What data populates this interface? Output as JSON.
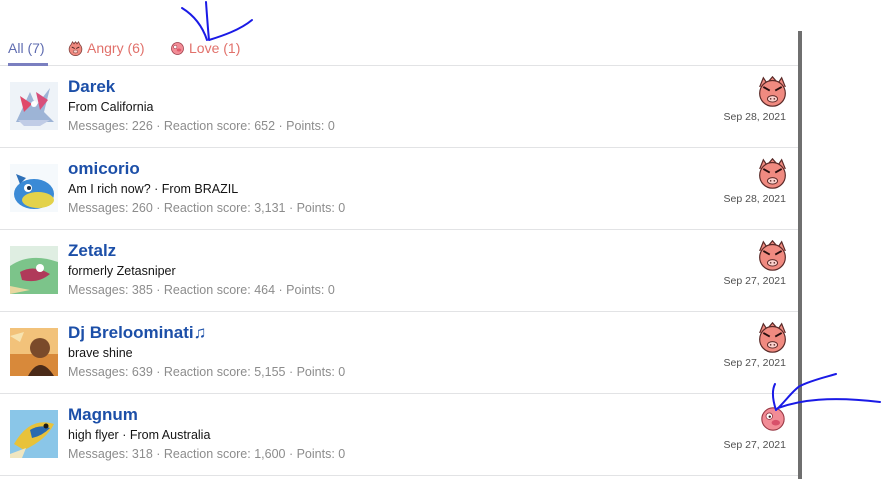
{
  "tabs": [
    {
      "label": "All (7)",
      "active": true
    },
    {
      "label": "Angry (6)",
      "icon": "angry-reaction-icon"
    },
    {
      "label": "Love (1)",
      "icon": "love-reaction-icon"
    }
  ],
  "users": [
    {
      "name": "Darek",
      "title": "From California",
      "stats": "Messages: 226 · Reaction score: 652 · Points: 0",
      "reaction": "angry",
      "date": "Sep 28, 2021"
    },
    {
      "name": "omicorio",
      "title": "Am I rich now? · From BRAZIL",
      "stats": "Messages: 260 · Reaction score: 3,131 · Points: 0",
      "reaction": "angry",
      "date": "Sep 28, 2021"
    },
    {
      "name": "Zetalz",
      "title": "formerly Zetasniper",
      "stats": "Messages: 385 · Reaction score: 464 · Points: 0",
      "reaction": "angry",
      "date": "Sep 27, 2021"
    },
    {
      "name": "Dj Breloominati♫",
      "title": "brave shine",
      "stats": "Messages: 639 · Reaction score: 5,155 · Points: 0",
      "reaction": "angry",
      "date": "Sep 27, 2021"
    },
    {
      "name": "Magnum",
      "title": "high flyer · From Australia",
      "stats": "Messages: 318 · Reaction score: 1,600 · Points: 0",
      "reaction": "love",
      "date": "Sep 27, 2021"
    }
  ],
  "colors": {
    "username": "#1c4fa8",
    "tab_active": "#5f6cb0",
    "tab_reaction": "#e1716b",
    "annotation_ink": "#1a1ae6",
    "reaction_angry": "#f08a80",
    "reaction_love": "#f28c96"
  }
}
